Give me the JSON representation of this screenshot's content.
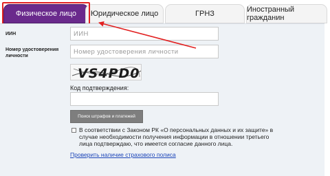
{
  "tabs": [
    {
      "label": "Физическое лицо",
      "active": true
    },
    {
      "label": "Юридическое лицо",
      "active": false
    },
    {
      "label": "ГРНЗ",
      "active": false
    },
    {
      "label": "Иностранный гражданин",
      "active": false
    }
  ],
  "form": {
    "iin_label": "ИИН",
    "iin_placeholder": "ИИН",
    "id_label_line1": "Номер удостоверения",
    "id_label_line2": "личности",
    "id_placeholder": "Номер удостоверения личности",
    "captcha_text": "VS4PD0",
    "code_label": "Код подтверждения:",
    "code_value": "",
    "search_button": "Поиск штрафов и платежей",
    "consent_text": "В соответствии с Законом РК «О персональных данных и их защите» в случае необходимости получения информации в отношении третьего лица подтверждаю, что имеется согласие данного лица.",
    "consent_checked": false,
    "insurance_link": "Проверить наличие страхового полиса"
  },
  "colors": {
    "active_tab": "#6a2a8c",
    "highlight": "#e22222",
    "button": "#7e7e7e",
    "link": "#1a44b8",
    "panel": "#eef2f6"
  }
}
